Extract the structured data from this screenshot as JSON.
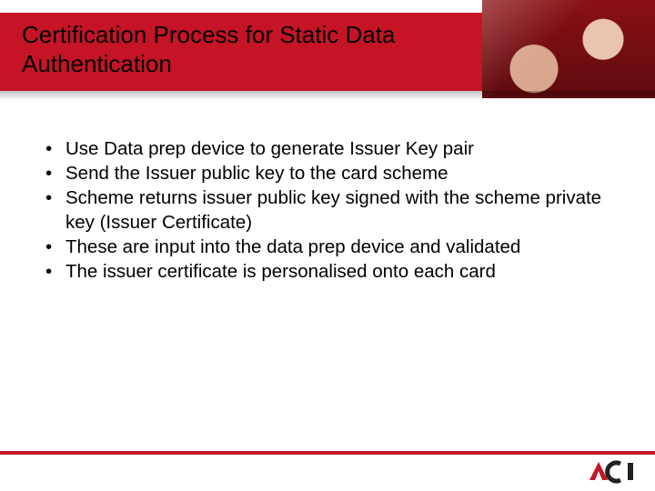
{
  "title": "Certification Process for Static Data Authentication",
  "bullets": {
    "b0": "Use Data prep device to generate Issuer Key pair",
    "b1": "Send the Issuer public key to the card scheme",
    "b2": "Scheme returns issuer public key signed with the scheme private key (Issuer Certificate)",
    "b3": "These are input into the data prep device and validated",
    "b4": "The issuer certificate is personalised onto each card"
  },
  "bullet_glyph": "•",
  "logo_text": "ACI"
}
